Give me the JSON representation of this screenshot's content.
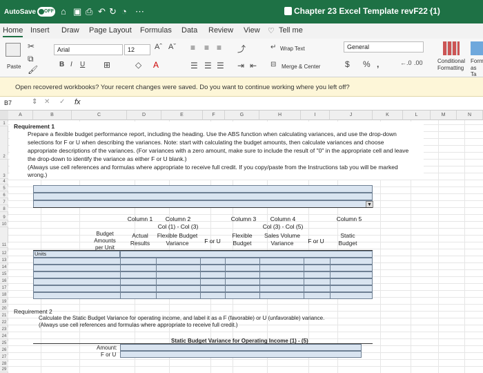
{
  "titlebar": {
    "autosave": "AutoSave",
    "toggle": "OFF",
    "doc_title": "Chapter 23 Excel Template revF22 (1)"
  },
  "tabs": [
    "Home",
    "Insert",
    "Draw",
    "Page Layout",
    "Formulas",
    "Data",
    "Review",
    "View",
    "Tell me"
  ],
  "ribbon": {
    "paste": "Paste",
    "font": "Arial",
    "size": "12",
    "wrap_text": "Wrap Text",
    "merge_center": "Merge & Center",
    "number_format": "General",
    "conditional": "Conditional",
    "formatting": "Formatting",
    "format_as": "Form",
    "format_as2": "as Ta"
  },
  "message": "Open recovered workbooks? Your recent changes were saved. Do you want to continue working where you left off?",
  "formula_bar": {
    "cell_ref": "B7",
    "fx": "fx"
  },
  "columns": [
    "A",
    "B",
    "C",
    "D",
    "E",
    "F",
    "G",
    "H",
    "I",
    "J",
    "K",
    "L",
    "M",
    "N"
  ],
  "rows": [
    "1",
    "2",
    "3",
    "4",
    "5",
    "6",
    "7",
    "8",
    "9",
    "10",
    "11",
    "12",
    "13",
    "14",
    "15",
    "16",
    "17",
    "18",
    "19",
    "20",
    "21",
    "22",
    "23",
    "24",
    "25",
    "26",
    "27",
    "28",
    "29"
  ],
  "sheet": {
    "req1_title": "Requirement 1",
    "req1_line1": "Prepare a flexible budget performance report, including the heading. Use the ABS function when calculating variances, and use the drop-down",
    "req1_line2": "selections for F or U when describing the variances. Note: start with calculating the budget amounts, then calculate variances and choose",
    "req1_line3": "appropriate descriptions of the variances. (For variances with a zero amount, make sure to include the result of \"0\" in the appropriate cell and leave",
    "req1_line4": "the drop-down to identify the variance as either F or U blank.)",
    "req1_line5": "(Always use cell references and formulas where appropriate to receive full credit. If you copy/paste from the Instructions tab you will be marked",
    "req1_line6": "wrong.)",
    "col1": "Column 1",
    "col2": "Column 2",
    "col2_sub": "Col (1) - Col (3)",
    "col3": "Column 3",
    "col4": "Column 4",
    "col4_sub": "Col (3) - Col (5)",
    "col5": "Column 5",
    "budget_amounts": "Budget Amounts per Unit",
    "actual_results": "Actual Results",
    "flex_variance": "Flexible Budget Variance",
    "f_or_u": "F or U",
    "flexible_budget": "Flexible Budget",
    "sales_volume_variance": "Sales Volume Variance",
    "f_or_u2": "F or U",
    "static_budget": "Static Budget",
    "units": "Units",
    "req2_title": "Requirement 2",
    "req2_line1": "Calculate the Static Budget Variance for operating income, and label it as a F (favorable) or U (unfavorable) variance.",
    "req2_line2": "(Always use cell references and formulas where appropriate to receive full credit.)",
    "static_heading": "Static Budget Variance for Operating Income (1) - (5)",
    "amount": "Amount:",
    "for_u": "F or U"
  }
}
